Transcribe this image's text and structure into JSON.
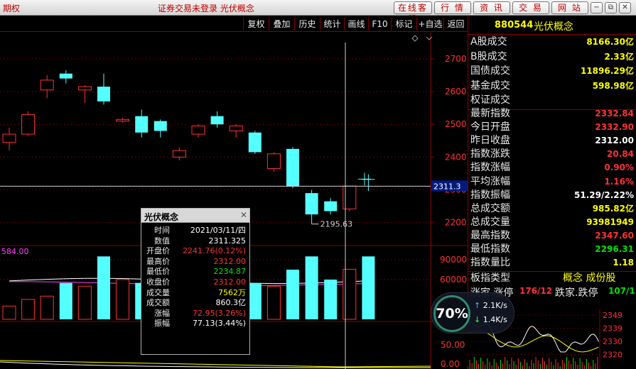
{
  "titlebar": {
    "left_title": "期权",
    "center_title": "证券交易未登录  光伏概念",
    "nav": [
      "在线客服",
      "行  情",
      "资  讯",
      "交  易",
      "网  站"
    ],
    "win": [
      "−",
      "⧉",
      "✕"
    ]
  },
  "toolbar": {
    "items": [
      "复权",
      "叠加",
      "历史",
      "统计",
      "画线",
      "F10",
      "标记",
      "+自选",
      "返回"
    ]
  },
  "colors": {
    "up": "#ff3232",
    "down": "#54ffff",
    "label": "#e8e8e8",
    "yellow": "#ffff00",
    "green": "#00e000",
    "white": "#ffffff"
  },
  "quote": {
    "code": "880544",
    "name": "光伏概念",
    "group1": [
      {
        "label": "A股成交",
        "value": "8166.30亿",
        "color": "yellow"
      },
      {
        "label": "B股成交",
        "value": "2.33亿",
        "color": "yellow"
      },
      {
        "label": "国债成交",
        "value": "11896.29亿",
        "color": "yellow"
      },
      {
        "label": "基金成交",
        "value": "598.98亿",
        "color": "yellow"
      },
      {
        "label": "权证成交",
        "value": "",
        "color": "yellow"
      }
    ],
    "group2": [
      {
        "label": "最新指数",
        "value": "2332.84",
        "color": "up"
      },
      {
        "label": "今日开盘",
        "value": "2332.90",
        "color": "up"
      },
      {
        "label": "昨日收盘",
        "value": "2312.00",
        "color": "white"
      },
      {
        "label": "指数涨跌",
        "value": "20.84",
        "color": "up"
      },
      {
        "label": "指数涨幅",
        "value": "0.90%",
        "color": "up"
      },
      {
        "label": "平均涨幅",
        "value": "1.16%",
        "color": "up"
      },
      {
        "label": "指数振幅",
        "value": "51.29/2.22%",
        "color": "white"
      },
      {
        "label": "总成交额",
        "value": "985.82亿",
        "color": "yellow"
      },
      {
        "label": "总成交量",
        "value": "93981949",
        "color": "yellow"
      },
      {
        "label": "最高指数",
        "value": "2347.60",
        "color": "up"
      },
      {
        "label": "最低指数",
        "value": "2296.31",
        "color": "green"
      },
      {
        "label": "指数量比",
        "value": "1.18",
        "color": "yellow"
      }
    ],
    "sector_label": "板指类型",
    "sector_value": "概念 成份股",
    "up_limit_label": "涨家.涨停",
    "up_limit_value": "176/12",
    "down_limit_label": "跌家.跌停",
    "down_limit_value": "107/1"
  },
  "speed": {
    "percent": "70%",
    "up": "2.1K/s",
    "down": "1.4K/s"
  },
  "tooltip": {
    "title": "光伏概念",
    "rows": [
      {
        "label": "时间",
        "value": "2021/03/11/四",
        "color": "white"
      },
      {
        "label": "数值",
        "value": "2311.325",
        "color": "white"
      },
      {
        "label": "开盘价",
        "value": "2241.76(0.12%)",
        "color": "up"
      },
      {
        "label": "最高价",
        "value": "2312.00",
        "color": "up"
      },
      {
        "label": "最低价",
        "value": "2234.87",
        "color": "green"
      },
      {
        "label": "收盘价",
        "value": "2312.00",
        "color": "up"
      },
      {
        "label": "成交量",
        "value": "7562万",
        "color": "yellow"
      },
      {
        "label": "成交额",
        "value": "860.3亿",
        "color": "white"
      },
      {
        "label": "涨幅",
        "value": "72.95(3.26%)",
        "color": "up"
      },
      {
        "label": "振幅",
        "value": "77.13(3.44%)",
        "color": "white"
      }
    ]
  },
  "chart_data": {
    "type": "candlestick",
    "price_ticks": [
      2700,
      2600,
      2500,
      2400,
      2300,
      2200
    ],
    "price_range": [
      2130,
      2780
    ],
    "crosshair_price": "2311.3",
    "low_marker": "2195.63",
    "volume_ticks": [
      90000,
      60000
    ],
    "volume_range": [
      0,
      105000
    ],
    "volume_left_label": "584.00",
    "indicator_ticks": [
      "50.00",
      "0.00"
    ],
    "candles": [
      {
        "o": 2445,
        "h": 2490,
        "l": 2420,
        "c": 2470,
        "v": 20000
      },
      {
        "o": 2470,
        "h": 2540,
        "l": 2465,
        "c": 2530,
        "v": 30000
      },
      {
        "o": 2605,
        "h": 2650,
        "l": 2580,
        "c": 2635,
        "v": 35000
      },
      {
        "o": 2655,
        "h": 2665,
        "l": 2625,
        "c": 2640,
        "v": 55000
      },
      {
        "o": 2605,
        "h": 2620,
        "l": 2565,
        "c": 2615,
        "v": 50000
      },
      {
        "o": 2615,
        "h": 2655,
        "l": 2560,
        "c": 2570,
        "v": 95000
      },
      {
        "o": 2510,
        "h": 2520,
        "l": 2505,
        "c": 2515,
        "v": 60000
      },
      {
        "o": 2525,
        "h": 2545,
        "l": 2460,
        "c": 2475,
        "v": 55000
      },
      {
        "o": 2510,
        "h": 2515,
        "l": 2460,
        "c": 2480,
        "v": 15000
      },
      {
        "o": 2400,
        "h": 2430,
        "l": 2390,
        "c": 2420,
        "v": 20000
      },
      {
        "o": 2470,
        "h": 2500,
        "l": 2460,
        "c": 2495,
        "v": 25000
      },
      {
        "o": 2525,
        "h": 2540,
        "l": 2490,
        "c": 2500,
        "v": 35000
      },
      {
        "o": 2480,
        "h": 2500,
        "l": 2460,
        "c": 2495,
        "v": 40000
      },
      {
        "o": 2475,
        "h": 2480,
        "l": 2410,
        "c": 2415,
        "v": 55000
      },
      {
        "o": 2365,
        "h": 2415,
        "l": 2355,
        "c": 2410,
        "v": 50000
      },
      {
        "o": 2425,
        "h": 2430,
        "l": 2305,
        "c": 2310,
        "v": 75000
      },
      {
        "o": 2290,
        "h": 2300,
        "l": 2195.63,
        "c": 2225,
        "v": 95000
      },
      {
        "o": 2265,
        "h": 2275,
        "l": 2225,
        "c": 2235,
        "v": 60000
      },
      {
        "o": 2241.76,
        "h": 2312,
        "l": 2234.87,
        "c": 2312,
        "v": 75620
      },
      {
        "o": 2332.9,
        "h": 2347.6,
        "l": 2296.31,
        "c": 2332.84,
        "v": 95000
      }
    ],
    "mini": {
      "ticks": [
        "2349",
        "2339",
        "2330",
        "2320"
      ]
    }
  }
}
